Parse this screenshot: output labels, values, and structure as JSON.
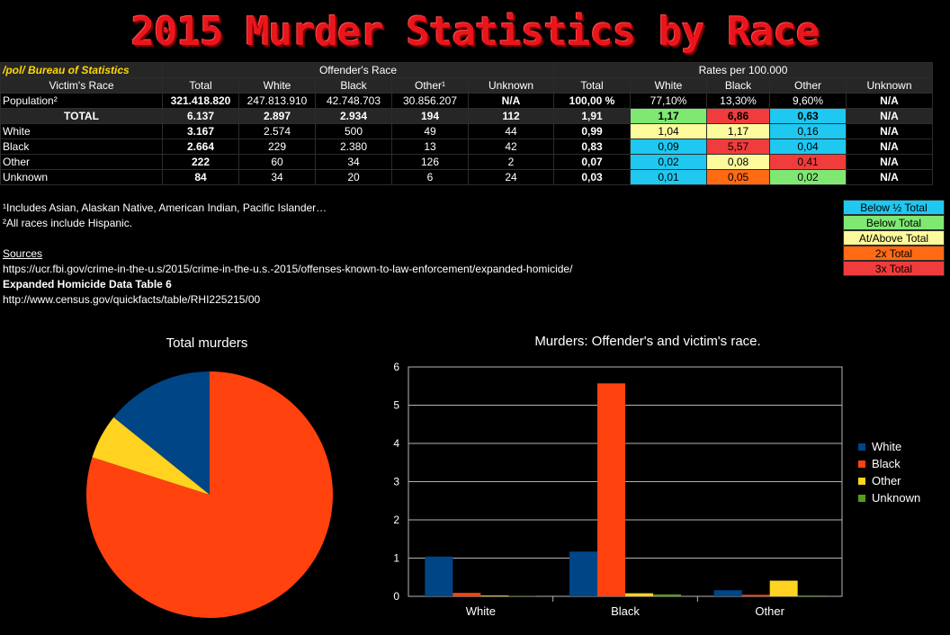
{
  "title": "2015 Murder Statistics by Race",
  "table": {
    "corner": "/pol/ Bureau of Statistics",
    "group_offender": "Offender's Race",
    "group_rates": "Rates per 100.000",
    "victim_label": "Victim's Race",
    "columns": [
      "Total",
      "White",
      "Black",
      "Other¹",
      "Unknown",
      "Total",
      "White",
      "Black",
      "Other",
      "Unknown"
    ],
    "population": {
      "label": "Population²",
      "cells": [
        "321.418.820",
        "247.813.910",
        "42.748.703",
        "30.856.207",
        "N/A",
        "100,00 %",
        "77,10%",
        "13,30%",
        "9,60%",
        "N/A"
      ]
    },
    "rows": [
      {
        "label": "TOTAL",
        "cells": [
          "6.137",
          "2.897",
          "2.934",
          "194",
          "112",
          "1,91",
          "1,17",
          "6,86",
          "0,63",
          "N/A"
        ],
        "rate_colors": [
          "green",
          "red",
          "cyan"
        ]
      },
      {
        "label": "White",
        "cells": [
          "3.167",
          "2.574",
          "500",
          "49",
          "44",
          "0,99",
          "1,04",
          "1,17",
          "0,16",
          "N/A"
        ],
        "rate_colors": [
          "yellow",
          "yellow",
          "cyan"
        ]
      },
      {
        "label": "Black",
        "cells": [
          "2.664",
          "229",
          "2.380",
          "13",
          "42",
          "0,83",
          "0,09",
          "5,57",
          "0,04",
          "N/A"
        ],
        "rate_colors": [
          "cyan",
          "red",
          "cyan"
        ]
      },
      {
        "label": "Other",
        "cells": [
          "222",
          "60",
          "34",
          "126",
          "2",
          "0,07",
          "0,02",
          "0,08",
          "0,41",
          "N/A"
        ],
        "rate_colors": [
          "cyan",
          "yellow",
          "red"
        ]
      },
      {
        "label": "Unknown",
        "cells": [
          "84",
          "34",
          "20",
          "6",
          "24",
          "0,03",
          "0,01",
          "0,05",
          "0,02",
          "N/A"
        ],
        "rate_colors": [
          "cyan",
          "orange",
          "green"
        ]
      }
    ]
  },
  "notes": {
    "note1": "¹Includes Asian, Alaskan Native, American Indian, Pacific Islander…",
    "note2": "²All races include Hispanic.",
    "sources_label": "Sources",
    "url1": "https://ucr.fbi.gov/crime-in-the-u.s/2015/crime-in-the-u.s.-2015/offenses-known-to-law-enforcement/expanded-homicide/",
    "table_ref": "Expanded Homicide Data Table 6",
    "url2": "http://www.census.gov/quickfacts/table/RHI225215/00"
  },
  "color_key": [
    {
      "label": "Below ½ Total",
      "color": "#1ec8f0"
    },
    {
      "label": "Below Total",
      "color": "#7fe873"
    },
    {
      "label": "At/Above Total",
      "color": "#fdfa9c"
    },
    {
      "label": "2x Total",
      "color": "#ff6a13"
    },
    {
      "label": "3x Total",
      "color": "#f03c3c"
    }
  ],
  "colors": {
    "white": "#004586",
    "black": "#ff420e",
    "other": "#ffd320",
    "unknown": "#579d1c",
    "title_red": "#e8161c"
  },
  "chart_data": [
    {
      "type": "pie",
      "title": "Total murders",
      "categories": [
        "White",
        "Black",
        "Other"
      ],
      "values": [
        0.99,
        5.57,
        0.41
      ],
      "colors": [
        "#004586",
        "#ff420e",
        "#ffd320"
      ]
    },
    {
      "type": "bar",
      "title": "Murders: Offender's and victim's race.",
      "categories": [
        "White",
        "Black",
        "Other"
      ],
      "ylim": [
        0,
        6
      ],
      "yticks": [
        "0",
        "1",
        "2",
        "3",
        "4",
        "5",
        "6"
      ],
      "series": [
        {
          "name": "White",
          "values": [
            1.04,
            1.17,
            0.16
          ],
          "color": "#004586"
        },
        {
          "name": "Black",
          "values": [
            0.09,
            5.57,
            0.04
          ],
          "color": "#ff420e"
        },
        {
          "name": "Other",
          "values": [
            0.02,
            0.08,
            0.41
          ],
          "color": "#ffd320"
        },
        {
          "name": "Unknown",
          "values": [
            0.01,
            0.05,
            0.02
          ],
          "color": "#579d1c"
        }
      ],
      "legend": "right"
    }
  ]
}
